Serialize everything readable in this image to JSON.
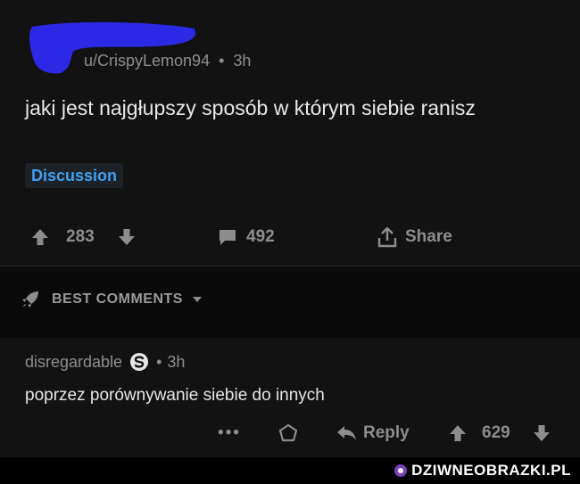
{
  "post": {
    "author": "u/CrispyLemon94",
    "separator": "•",
    "age": "3h",
    "title": "jaki jest najgłupszy sposób w którym siebie ranisz",
    "flair": "Discussion",
    "score": "283",
    "comments_count": "492",
    "share_label": "Share"
  },
  "sort": {
    "label": "BEST COMMENTS"
  },
  "comment": {
    "author": "disregardable",
    "separator": "•",
    "age": "3h",
    "body": "poprzez porównywanie siebie do innych",
    "more_label": "•••",
    "reply_label": "Reply",
    "score": "629"
  },
  "watermark": {
    "text": "DZIWNEOBRAZKI.PL"
  },
  "colors": {
    "background": "#0a0a0a",
    "card": "#121212",
    "flair_text": "#3ea0f0",
    "redaction": "#2b28e6",
    "muted": "#8d8d8d"
  },
  "icons": {
    "upvote": "arrow-up-icon",
    "downvote": "arrow-down-icon",
    "comments": "speech-bubble-icon",
    "share": "share-icon",
    "sort": "rocket-icon",
    "award": "award-icon",
    "reply": "reply-arrow-icon",
    "badge": "s-badge-icon"
  }
}
